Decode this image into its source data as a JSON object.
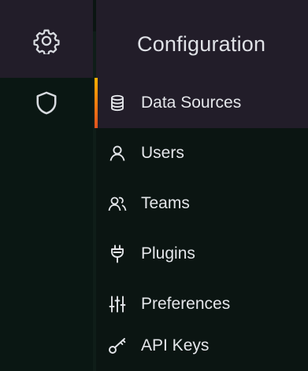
{
  "rail": {
    "items": [
      {
        "icon": "gear-icon"
      },
      {
        "icon": "shield-icon"
      }
    ]
  },
  "panel": {
    "title": "Configuration",
    "items": [
      {
        "label": "Data Sources",
        "icon": "database-icon",
        "active": true
      },
      {
        "label": "Users",
        "icon": "user-icon",
        "active": false
      },
      {
        "label": "Teams",
        "icon": "users-icon",
        "active": false
      },
      {
        "label": "Plugins",
        "icon": "plug-icon",
        "active": false
      },
      {
        "label": "Preferences",
        "icon": "sliders-icon",
        "active": false
      },
      {
        "label": "API Keys",
        "icon": "key-icon",
        "active": false
      }
    ]
  },
  "colors": {
    "header_bg": "#221d29",
    "panel_bg": "#0b1512",
    "active_bar_top": "#fbb000",
    "active_bar_bottom": "#e0521f"
  }
}
